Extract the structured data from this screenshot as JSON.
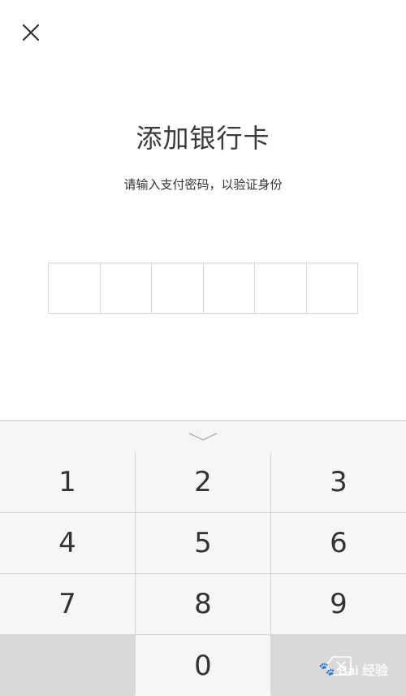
{
  "header": {
    "close_icon": "close-icon"
  },
  "main": {
    "title": "添加银行卡",
    "subtitle": "请输入支付密码，以验证身份",
    "pin_length": 6
  },
  "keyboard": {
    "collapse_icon": "chevron-down-icon",
    "keys": [
      "1",
      "2",
      "3",
      "4",
      "5",
      "6",
      "7",
      "8",
      "9",
      "",
      "0",
      "⌫"
    ]
  },
  "watermark": {
    "text": "Bai 经验"
  },
  "colors": {
    "background": "#ffffff",
    "text": "#333333",
    "pin_border": "#d6d6d6",
    "key_bg": "#f6f6f6",
    "key_dark_bg": "#d9d9d9"
  }
}
